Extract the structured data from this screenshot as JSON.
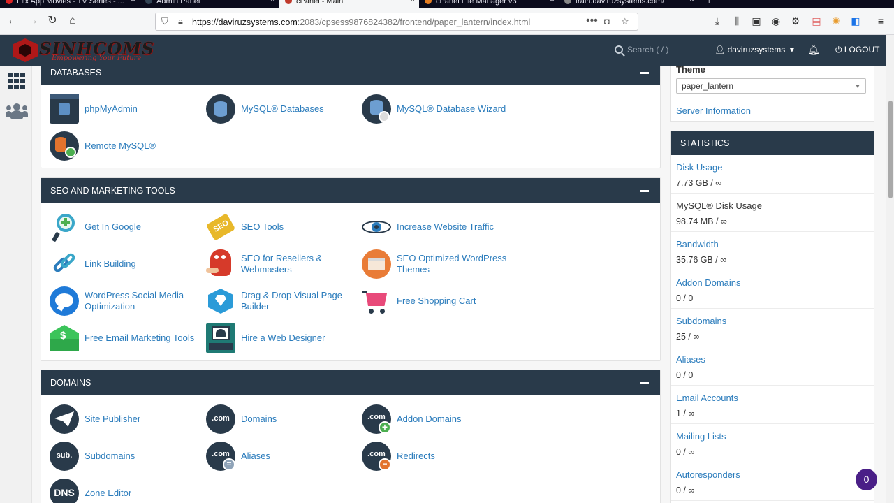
{
  "browser": {
    "tabs": [
      {
        "label": "Flix App Movies - TV Series - ..."
      },
      {
        "label": "Admin Panel"
      },
      {
        "label": "cPanel - Main"
      },
      {
        "label": "cPanel File Manager v3"
      },
      {
        "label": "train.daviruzsystems.com/"
      }
    ],
    "url_host": "https://daviruzsystems.com",
    "url_path": ":2083/cpsess9876824382/frontend/paper_lantern/index.html"
  },
  "header": {
    "logo_name": "SINHCOMS",
    "logo_tagline": "Empowering Your Future",
    "search_placeholder": "Search ( / )",
    "username": "daviruzsystems",
    "logout_label": "LOGOUT"
  },
  "sections": {
    "databases": {
      "title": "DATABASES",
      "items": [
        {
          "label": "phpMyAdmin",
          "icon": "database-icon"
        },
        {
          "label": "MySQL® Databases",
          "icon": "database-icon"
        },
        {
          "label": "MySQL® Database Wizard",
          "icon": "database-wizard-icon"
        },
        {
          "label": "Remote MySQL®",
          "icon": "remote-database-icon"
        }
      ]
    },
    "seo": {
      "title": "SEO AND MARKETING TOOLS",
      "items": [
        {
          "label": "Get In Google",
          "icon": "magnifier-plus-icon"
        },
        {
          "label": "SEO Tools",
          "icon": "seo-tag-icon"
        },
        {
          "label": "Increase Website Traffic",
          "icon": "eye-icon"
        },
        {
          "label": "Link Building",
          "icon": "chain-link-icon"
        },
        {
          "label": "SEO for Resellers & Webmasters",
          "icon": "mascot-icon"
        },
        {
          "label": "SEO Optimized WordPress Themes",
          "icon": "theme-window-icon"
        },
        {
          "label": "WordPress Social Media Optimization",
          "icon": "chat-bubble-icon"
        },
        {
          "label": "Drag & Drop Visual Page Builder",
          "icon": "diamond-icon"
        },
        {
          "label": "Free Shopping Cart",
          "icon": "shopping-cart-icon"
        },
        {
          "label": "Free Email Marketing Tools",
          "icon": "dollar-envelope-icon"
        },
        {
          "label": "Hire a Web Designer",
          "icon": "designer-icon"
        }
      ]
    },
    "domains": {
      "title": "DOMAINS",
      "items": [
        {
          "label": "Site Publisher",
          "icon": "paper-plane-icon",
          "glyph": ""
        },
        {
          "label": "Domains",
          "icon": "dotcom-icon",
          "glyph": ".com"
        },
        {
          "label": "Addon Domains",
          "icon": "dotcom-add-icon",
          "glyph": ".com"
        },
        {
          "label": "Subdomains",
          "icon": "sub-icon",
          "glyph": "sub."
        },
        {
          "label": "Aliases",
          "icon": "dotcom-alias-icon",
          "glyph": ".com"
        },
        {
          "label": "Redirects",
          "icon": "dotcom-redirect-icon",
          "glyph": ".com"
        },
        {
          "label": "Zone Editor",
          "icon": "dns-icon",
          "glyph": "DNS"
        }
      ]
    }
  },
  "sidebar_right": {
    "theme_label": "Theme",
    "theme_value": "paper_lantern",
    "server_info": "Server Information",
    "statistics": {
      "title": "STATISTICS",
      "items": [
        {
          "name": "Disk Usage",
          "value": "7.73 GB / ∞"
        },
        {
          "name": "MySQL® Disk Usage",
          "value": "98.74 MB / ∞"
        },
        {
          "name": "Bandwidth",
          "value": "35.76 GB / ∞"
        },
        {
          "name": "Addon Domains",
          "value": "0 / 0"
        },
        {
          "name": "Subdomains",
          "value": "25 / ∞"
        },
        {
          "name": "Aliases",
          "value": "0 / 0"
        },
        {
          "name": "Email Accounts",
          "value": "1 / ∞"
        },
        {
          "name": "Mailing Lists",
          "value": "0 / ∞"
        },
        {
          "name": "Autoresponders",
          "value": "0 / ∞"
        }
      ]
    }
  },
  "notification_badge": "0",
  "colors": {
    "header_bg": "#293a4a",
    "link": "#2b7cbc",
    "badge": "#4a1f87"
  }
}
